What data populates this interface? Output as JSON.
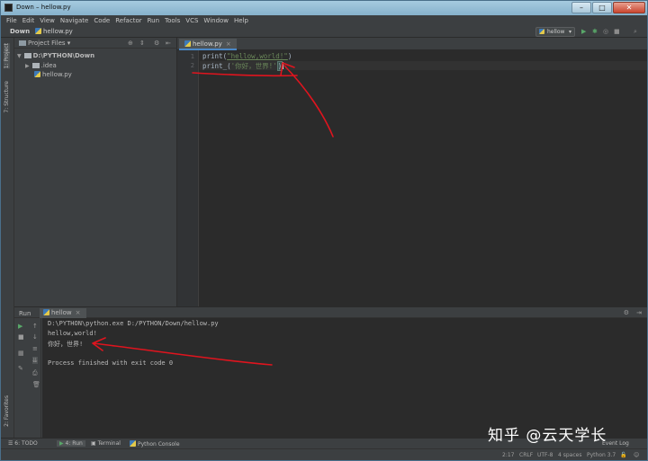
{
  "window": {
    "title": "Down – hellow.py",
    "min": "–",
    "max": "□",
    "close": "✕"
  },
  "menu": [
    "File",
    "Edit",
    "View",
    "Navigate",
    "Code",
    "Refactor",
    "Run",
    "Tools",
    "VCS",
    "Window",
    "Help"
  ],
  "navbar": {
    "project": "Down",
    "file": "hellow.py",
    "run_config": "hellow"
  },
  "left_stripe": {
    "project_tab": "1: Project",
    "structure_tab": "7: Structure",
    "favorites_tab": "2: Favorites"
  },
  "project_panel": {
    "title": "Project Files",
    "tree": [
      {
        "label": "D:\\PYTHON\\Down",
        "type": "folder",
        "expanded": true
      },
      {
        "label": ".idea",
        "type": "folder",
        "expanded": false
      },
      {
        "label": "hellow.py",
        "type": "python-file"
      }
    ]
  },
  "editor": {
    "tab": "hellow.py",
    "lines": [
      {
        "no": "1",
        "pre": "print(",
        "str": "\"hellow,world!\"",
        "post": ")"
      },
      {
        "no": "2",
        "pre": "print_(",
        "str": "'你好，世界!'",
        "post": ")"
      }
    ]
  },
  "run": {
    "label": "Run",
    "tab": "hellow",
    "console": [
      "D:\\PYTHON\\python.exe D:/PYTHON/Down/hellow.py",
      "hellow,world!",
      "你好，世界!",
      "",
      "Process finished with exit code 0"
    ]
  },
  "bottom_tabs": {
    "todo": "6: TODO",
    "run": "4: Run",
    "terminal": "Terminal",
    "python_console": "Python Console",
    "event_log": "Event Log"
  },
  "status": {
    "position": "2:17",
    "line_sep": "CRLF",
    "encoding": "UTF-8",
    "indent": "4 spaces",
    "interpreter": "Python 3.7"
  },
  "watermark": "知乎 @云天学长",
  "colors": {
    "accent": "#4a88c7",
    "string": "#6a8759",
    "annotation": "#e0141e",
    "run_green": "#59a869"
  }
}
